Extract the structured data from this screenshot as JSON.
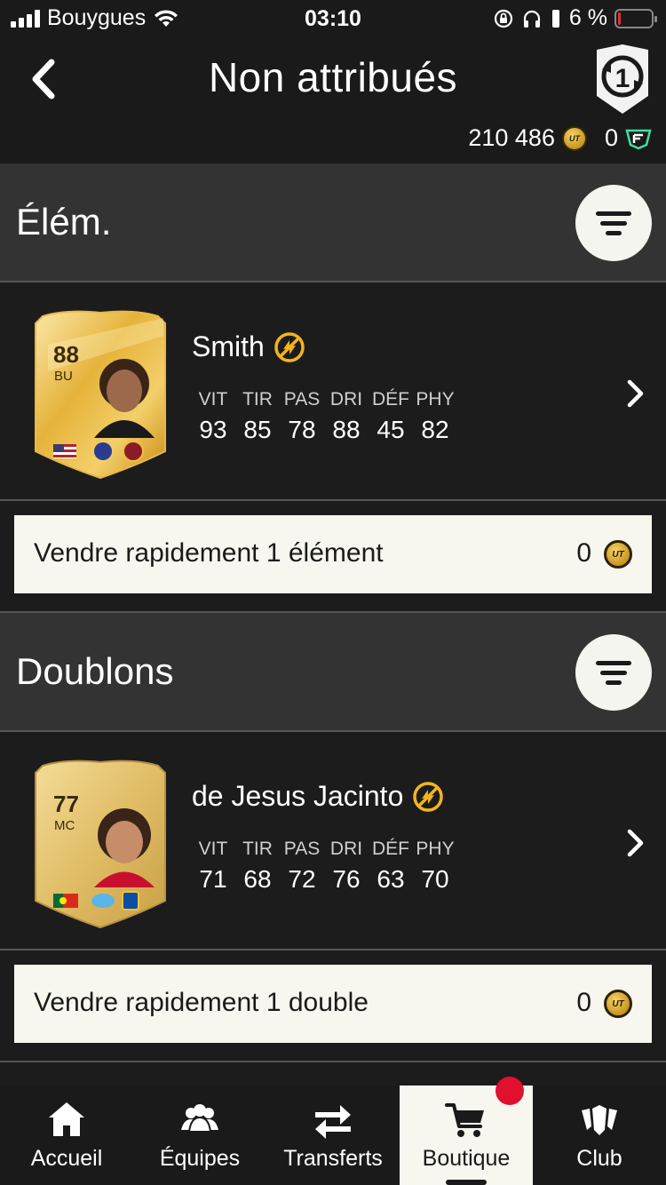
{
  "status_bar": {
    "carrier": "Bouygues",
    "time": "03:10",
    "battery_percent": "6 %",
    "battery_level": 0.06
  },
  "header": {
    "title": "Non attribués",
    "coins": "210 486",
    "points": "0",
    "badge_number": "1"
  },
  "sections": [
    {
      "title": "Élém.",
      "player": {
        "rating": "88",
        "position": "BU",
        "name": "Smith",
        "stats": [
          {
            "label": "VIT",
            "value": "93"
          },
          {
            "label": "TIR",
            "value": "85"
          },
          {
            "label": "PAS",
            "value": "78"
          },
          {
            "label": "DRI",
            "value": "88"
          },
          {
            "label": "DÉF",
            "value": "45"
          },
          {
            "label": "PHY",
            "value": "82"
          }
        ]
      },
      "quick_sell": {
        "label": "Vendre rapidement 1 élément",
        "value": "0"
      }
    },
    {
      "title": "Doublons",
      "player": {
        "rating": "77",
        "position": "MC",
        "name": "de Jesus Jacinto",
        "stats": [
          {
            "label": "VIT",
            "value": "71"
          },
          {
            "label": "TIR",
            "value": "68"
          },
          {
            "label": "PAS",
            "value": "72"
          },
          {
            "label": "DRI",
            "value": "76"
          },
          {
            "label": "DÉF",
            "value": "63"
          },
          {
            "label": "PHY",
            "value": "70"
          }
        ]
      },
      "quick_sell": {
        "label": "Vendre rapidement 1 double",
        "value": "0"
      }
    }
  ],
  "nav": [
    {
      "label": "Accueil",
      "icon": "home-icon"
    },
    {
      "label": "Équipes",
      "icon": "teams-icon"
    },
    {
      "label": "Transferts",
      "icon": "transfer-arrows-icon"
    },
    {
      "label": "Boutique",
      "icon": "cart-icon"
    },
    {
      "label": "Club",
      "icon": "club-icon"
    }
  ],
  "coin_label": "UT",
  "colors": {
    "accent_gold": "#f2b51f",
    "notification": "#e0102e",
    "background": "#1c1c1c",
    "section": "#333333",
    "light_button": "#f7f7f0"
  }
}
